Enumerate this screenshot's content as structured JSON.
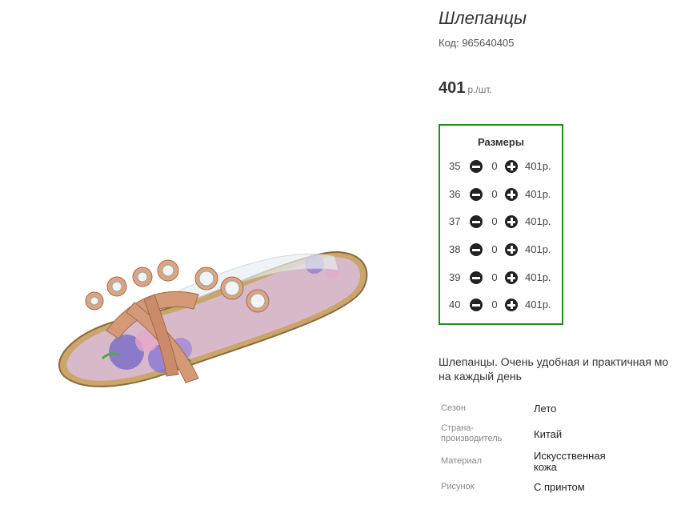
{
  "product": {
    "title": "Шлепанцы",
    "code": "Код: 965640405",
    "price": "401",
    "price_unit": "р./шт."
  },
  "sizes": {
    "title": "Размеры",
    "rows": [
      {
        "size": "35",
        "qty": "0",
        "price": "401р."
      },
      {
        "size": "36",
        "qty": "0",
        "price": "401р."
      },
      {
        "size": "37",
        "qty": "0",
        "price": "401р."
      },
      {
        "size": "38",
        "qty": "0",
        "price": "401р."
      },
      {
        "size": "39",
        "qty": "0",
        "price": "401р."
      },
      {
        "size": "40",
        "qty": "0",
        "price": "401р."
      }
    ]
  },
  "description": {
    "line1": "Шлепанцы. Очень удобная и практичная мо",
    "line2": "на каждый день"
  },
  "properties": [
    {
      "key": "Сезон",
      "value": "Лето"
    },
    {
      "key": "Страна-производитель",
      "value": "Китай"
    },
    {
      "key": "Материал",
      "value": "Искусственная кожа"
    },
    {
      "key": "Рисунок",
      "value": "С принтом"
    }
  ],
  "colors": {
    "accent_border": "#1e8c1e"
  }
}
